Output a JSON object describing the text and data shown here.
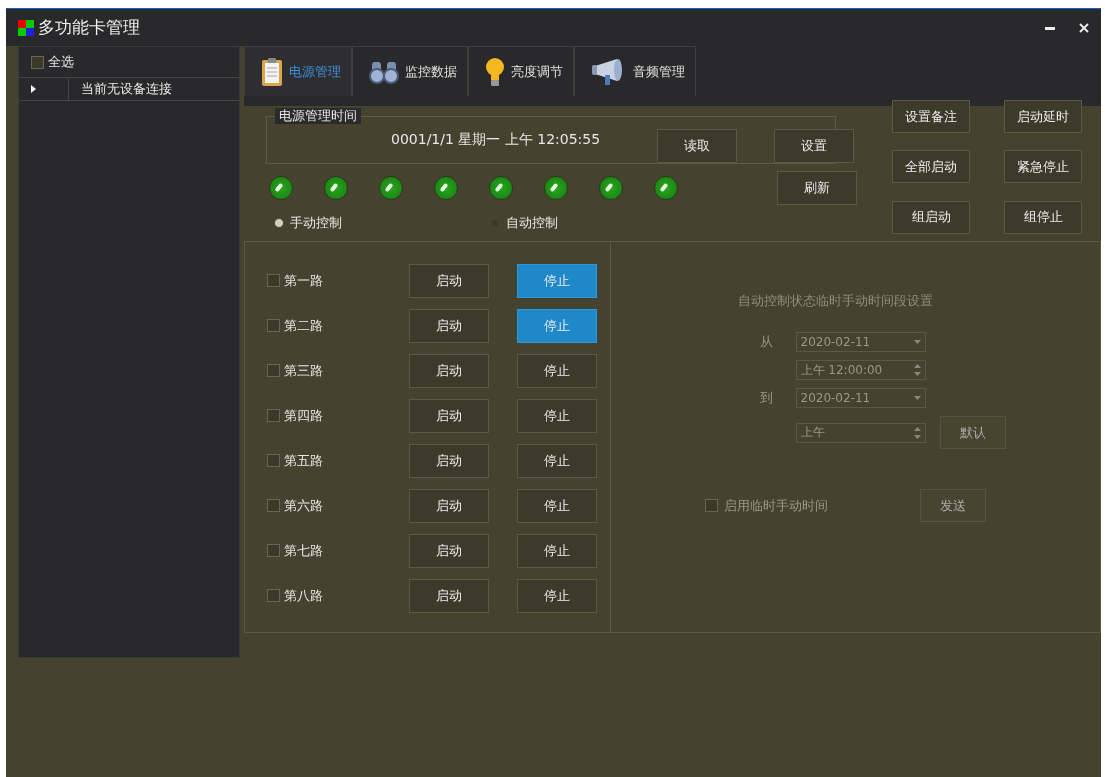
{
  "window": {
    "title": "多功能卡管理"
  },
  "sidebar": {
    "select_all": {
      "label": "全选",
      "checked": false
    },
    "tree": [
      {
        "label": "当前无设备连接",
        "expanded": false
      }
    ]
  },
  "tabs": [
    {
      "label": "电源管理",
      "kind": "clipboard",
      "selected": true
    },
    {
      "label": "监控数据",
      "kind": "binoculars",
      "selected": false
    },
    {
      "label": "亮度调节",
      "kind": "bulb",
      "selected": false
    },
    {
      "label": "音频管理",
      "kind": "megaphone",
      "selected": false
    }
  ],
  "power_time": {
    "title": "电源管理时间",
    "value": "0001/1/1 星期一 上午 12:05:55",
    "read_button": "读取",
    "set_button": "设置",
    "refresh_button": "刷新"
  },
  "indicators": [
    {
      "on": true
    },
    {
      "on": true
    },
    {
      "on": true
    },
    {
      "on": true
    },
    {
      "on": true
    },
    {
      "on": true
    },
    {
      "on": true
    },
    {
      "on": true
    }
  ],
  "modes": [
    {
      "label": "手动控制",
      "selected": true
    },
    {
      "label": "自动控制",
      "selected": false
    }
  ],
  "actions": [
    "设置备注",
    "启动延时",
    "全部启动",
    "紧急停止",
    "组启动",
    "组停止"
  ],
  "channels": [
    {
      "label": "第一路",
      "checked": false,
      "start": "启动",
      "stop": "停止",
      "stopped": true
    },
    {
      "label": "第二路",
      "checked": false,
      "start": "启动",
      "stop": "停止",
      "stopped": true
    },
    {
      "label": "第三路",
      "checked": false,
      "start": "启动",
      "stop": "停止",
      "stopped": false
    },
    {
      "label": "第四路",
      "checked": false,
      "start": "启动",
      "stop": "停止",
      "stopped": false
    },
    {
      "label": "第五路",
      "checked": false,
      "start": "启动",
      "stop": "停止",
      "stopped": false
    },
    {
      "label": "第六路",
      "checked": false,
      "start": "启动",
      "stop": "停止",
      "stopped": false
    },
    {
      "label": "第七路",
      "checked": false,
      "start": "启动",
      "stop": "停止",
      "stopped": false
    },
    {
      "label": "第八路",
      "checked": false,
      "start": "启动",
      "stop": "停止",
      "stopped": false
    }
  ],
  "schedule": {
    "title": "自动控制状态临时手动时间段设置",
    "from_label": "从",
    "from_date": "2020-02-11",
    "from_time": "上午 12:00:00",
    "to_label": "到",
    "to_date": "2020-02-11",
    "to_time": "上午",
    "default_button": "默认",
    "enable": {
      "label": "启用临时手动时间",
      "checked": false
    },
    "send_button": "发送"
  }
}
